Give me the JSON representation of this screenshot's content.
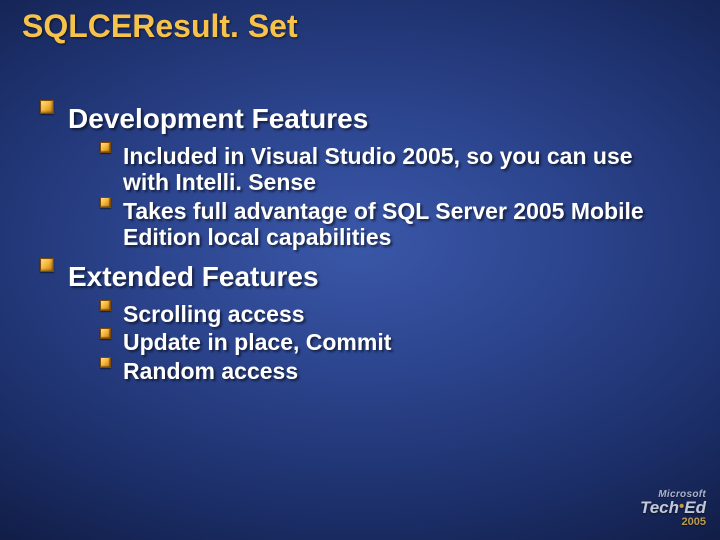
{
  "title": "SQLCEResult. Set",
  "sections": [
    {
      "heading": "Development Features",
      "items": [
        "Included in Visual Studio 2005, so you can use with Intelli. Sense",
        "Takes full advantage of SQL Server 2005 Mobile Edition local capabilities"
      ]
    },
    {
      "heading": "Extended Features",
      "items": [
        "Scrolling access",
        "Update in place, Commit",
        "Random access"
      ]
    }
  ],
  "branding": {
    "vendor": "Microsoft",
    "product_a": "Tech",
    "product_b": "Ed",
    "year": "2005"
  }
}
